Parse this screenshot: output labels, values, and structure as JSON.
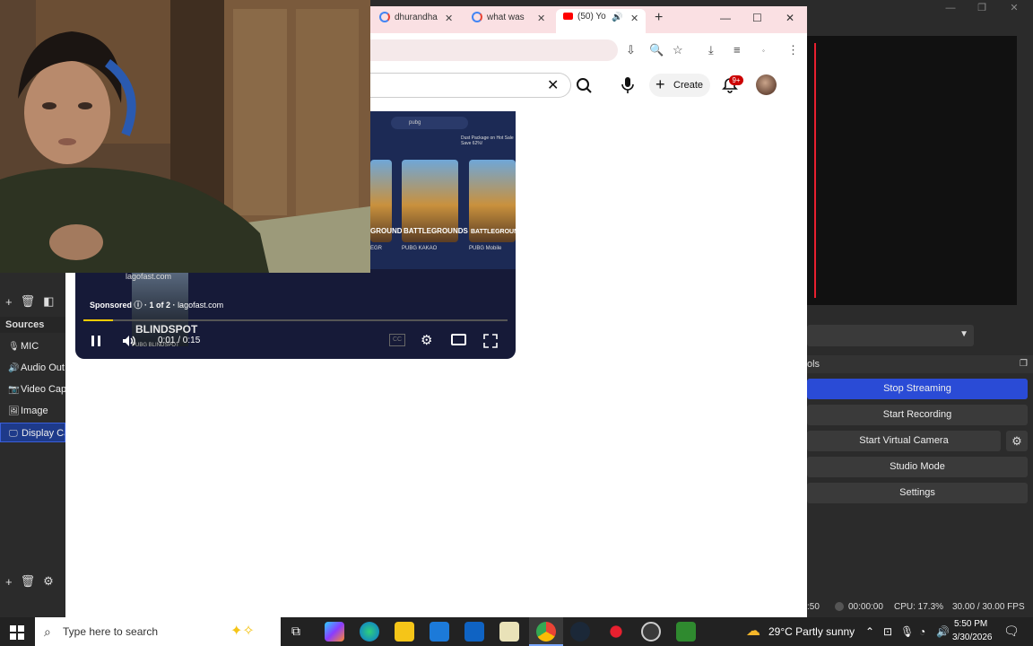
{
  "obs": {
    "controls_label": "ols",
    "buttons": {
      "stop_streaming": "Stop Streaming",
      "start_recording": "Start Recording",
      "start_virtual_camera": "Start Virtual Camera",
      "studio_mode": "Studio Mode",
      "settings": "Settings"
    },
    "sources_header": "Sources",
    "sources": [
      "MIC",
      "Audio Out",
      "Video Cap",
      "Image",
      "Display Ca"
    ],
    "status": {
      "stream_time_partial": ":50",
      "rec_time": "00:00:00",
      "cpu": "CPU: 17.3%",
      "fps": "30.00 / 30.00 FPS"
    }
  },
  "chrome": {
    "tabs": [
      {
        "label": "dhurandha"
      },
      {
        "label": "what was "
      },
      {
        "label": "(50) Yo"
      }
    ]
  },
  "youtube": {
    "create_label": "Create",
    "notif_badge": "9+"
  },
  "player": {
    "sponsored_label": "Sponsored",
    "ad_counter": "1 of 2 ·",
    "ad_domain": "lagofast.com",
    "ad_domain_top": "lagofast.com",
    "time": "0:01 / 0:15",
    "progress_fraction": 0.07,
    "ad_title": "BLINDSPOT",
    "ad_subtitle": "PUBG BLINDSPOT",
    "search_text": "pubg",
    "promo_text": "Dust Package on Hot Sale Save 62%!",
    "games": [
      {
        "name": "EGR"
      },
      {
        "name": "PUBG KAKAO"
      },
      {
        "name": "PUBG Mobile"
      }
    ],
    "card_titles": [
      "GROUNDS",
      "BATTLEGROUNDS",
      "BATTLEGROUNDS"
    ]
  },
  "taskbar": {
    "search_placeholder": "Type here to search",
    "weather": "29°C  Partly sunny",
    "time": "5:50 PM",
    "date": "3/30/2026"
  }
}
